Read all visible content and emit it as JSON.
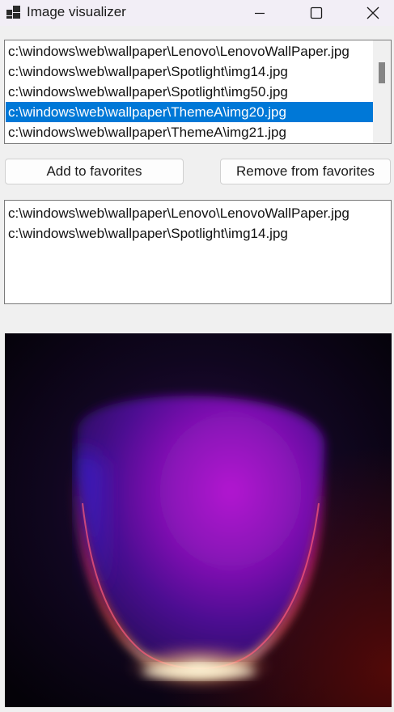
{
  "window": {
    "title": "Image visualizer",
    "icons": {
      "app": "app-icon",
      "minimize": "minimize-icon",
      "maximize": "maximize-icon",
      "close": "close-icon"
    }
  },
  "file_list": {
    "items": [
      "c:\\windows\\web\\wallpaper\\Lenovo\\LenovoWallPaper.jpg",
      "c:\\windows\\web\\wallpaper\\Spotlight\\img14.jpg",
      "c:\\windows\\web\\wallpaper\\Spotlight\\img50.jpg",
      "c:\\windows\\web\\wallpaper\\ThemeA\\img20.jpg",
      "c:\\windows\\web\\wallpaper\\ThemeA\\img21.jpg"
    ],
    "selected_index": 3,
    "colors": {
      "selection": "#0078d7"
    }
  },
  "buttons": {
    "add": "Add to favorites",
    "remove": "Remove from favorites"
  },
  "favorites": {
    "items": [
      "c:\\windows\\web\\wallpaper\\Lenovo\\LenovoWallPaper.jpg",
      "c:\\windows\\web\\wallpaper\\Spotlight\\img14.jpg"
    ]
  }
}
